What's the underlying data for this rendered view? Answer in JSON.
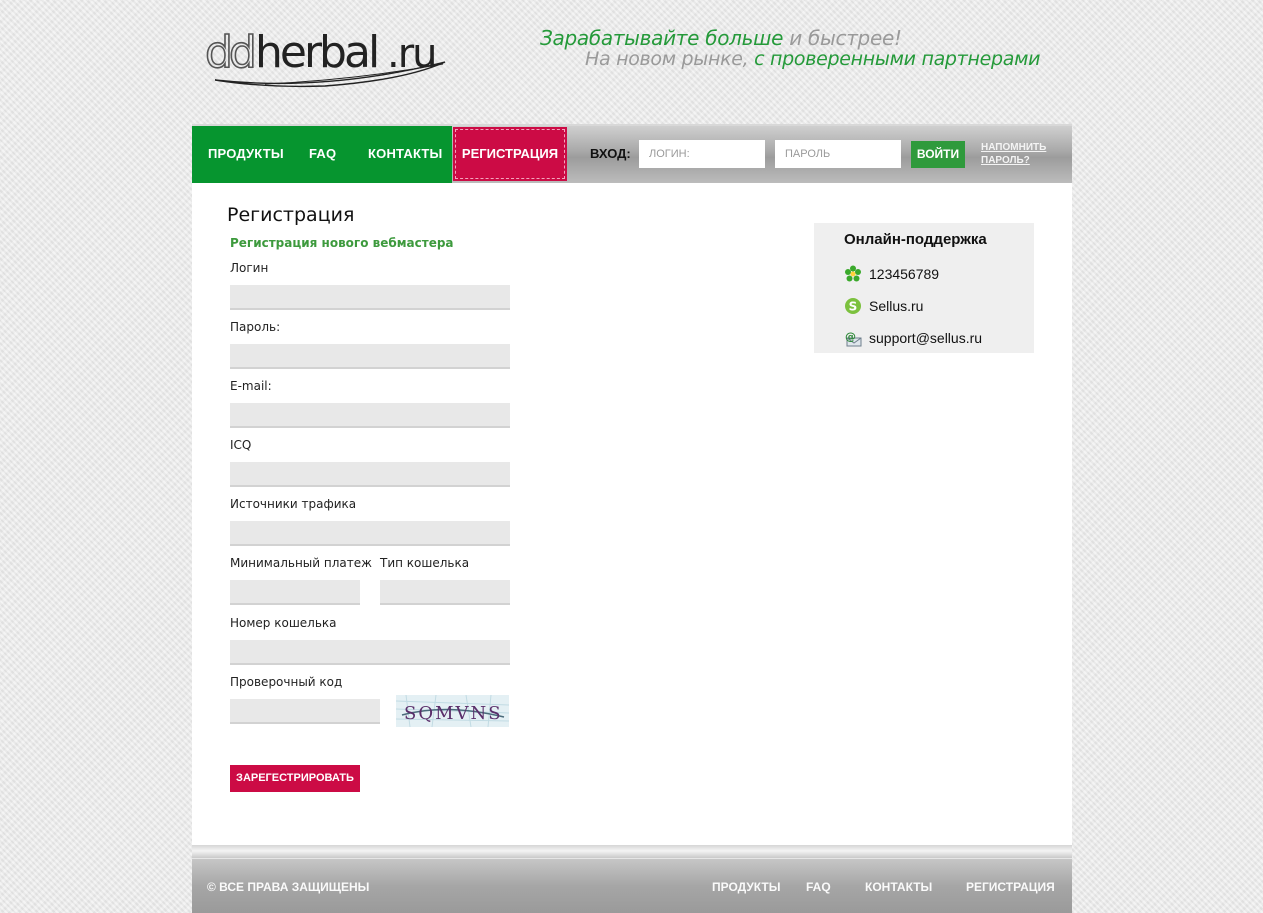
{
  "header": {
    "logo_text": "ddherbal.ru",
    "slogan_line1": {
      "part1": "Зарабатывайте больше",
      "part2": " и быстрее!"
    },
    "slogan_line2": {
      "part1": "На новом рынке, ",
      "part2": "с проверенными партнерами"
    }
  },
  "nav": {
    "items": [
      {
        "label": "ПРОДУКТЫ"
      },
      {
        "label": "FAQ"
      },
      {
        "label": "КОНТАКТЫ"
      },
      {
        "label": "РЕГИСТРАЦИЯ"
      }
    ],
    "login_label": "ВХОД:",
    "login_placeholder": "ЛОГИН:",
    "password_placeholder": "ПАРОЛЬ",
    "login_button": "ВОЙТИ",
    "remind_line1": "НАПОМНИТЬ",
    "remind_line2": "ПАРОЛЬ?"
  },
  "form": {
    "title": "Регистрация",
    "subtitle": "Регистрация нового вебмастера",
    "labels": {
      "login": "Логин",
      "password": "Пароль:",
      "email": "E-mail:",
      "icq": "ICQ",
      "traffic": "Источники трафика",
      "min_payment": "Минимальный платеж",
      "wallet_type": "Тип кошелька",
      "wallet_number": "Номер кошелька",
      "captcha": "Проверочный код"
    },
    "captcha_text": "SQMVNS",
    "submit": "ЗАРЕГЕСТРИРОВАТЬ"
  },
  "support": {
    "title": "Онлайн-поддержка",
    "icq": "123456789",
    "skype": "Sellus.ru",
    "email": "support@sellus.ru"
  },
  "footer": {
    "copyright": "© ВСЕ ПРАВА ЗАЩИЩЕНЫ",
    "links": [
      {
        "label": "ПРОДУКТЫ"
      },
      {
        "label": "FAQ"
      },
      {
        "label": "КОНТАКТЫ"
      },
      {
        "label": "РЕГИСТРАЦИЯ"
      }
    ]
  },
  "colors": {
    "green": "#06952f",
    "accent_red": "#cc0b45",
    "text_green": "#3d9a3d"
  }
}
